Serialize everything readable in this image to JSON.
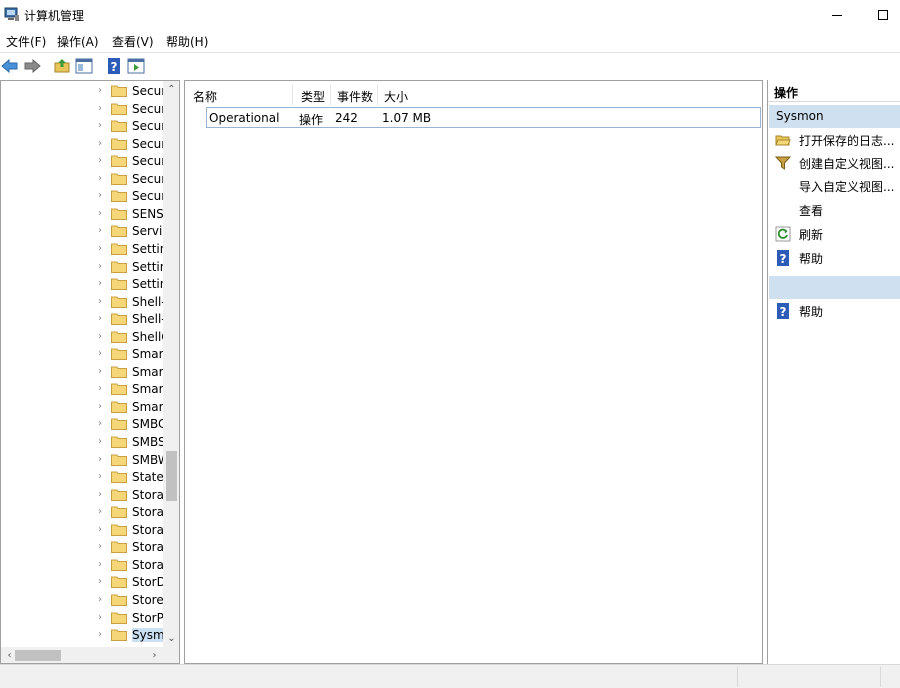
{
  "window": {
    "title": "计算机管理",
    "minimize_icon": "minimize-icon",
    "maximize_icon": "maximize-icon"
  },
  "menu": {
    "items": [
      "文件(F)",
      "操作(A)",
      "查看(V)",
      "帮助(H)"
    ]
  },
  "toolbar": {
    "icons": [
      "back-arrow-icon",
      "forward-arrow-icon",
      "up-folder-icon",
      "show-hide-console-tree-icon",
      "help-icon",
      "show-hide-action-pane-icon"
    ]
  },
  "tree": {
    "items": [
      "Secur",
      "Secur",
      "Secur",
      "Secur",
      "Secur",
      "Secur",
      "Secur",
      "SENS",
      "Servic",
      "Settin",
      "Settin",
      "Settin",
      "Shell-",
      "Shell-",
      "ShellC",
      "Smart",
      "Smart",
      "Smart",
      "Smart",
      "SMBC",
      "SMBS",
      "SMBW",
      "StateF",
      "Storag",
      "Storag",
      "Storag",
      "Storag",
      "Storag",
      "StorD",
      "Store",
      "StorPo",
      "Sysmo"
    ],
    "selected_index": 31,
    "folder_color": "#f5d77a"
  },
  "list": {
    "columns": [
      "名称",
      "类型",
      "事件数",
      "大小"
    ],
    "rows": [
      {
        "name": "Operational",
        "type": "操作",
        "count": "242",
        "size": "1.07 MB"
      }
    ]
  },
  "actions": {
    "title": "操作",
    "section1": "Sysmon",
    "items": [
      {
        "label": "打开保存的日志...",
        "icon": "open-folder-icon"
      },
      {
        "label": "创建自定义视图...",
        "icon": "filter-funnel-icon"
      },
      {
        "label": "导入自定义视图...",
        "icon": ""
      },
      {
        "label": "查看",
        "icon": ""
      },
      {
        "label": "刷新",
        "icon": "refresh-icon"
      },
      {
        "label": "帮助",
        "icon": "help-icon"
      }
    ],
    "section2": "",
    "section2_items": [
      {
        "label": "帮助",
        "icon": "help-icon"
      }
    ],
    "section_header_color": "#cfe0f0"
  }
}
